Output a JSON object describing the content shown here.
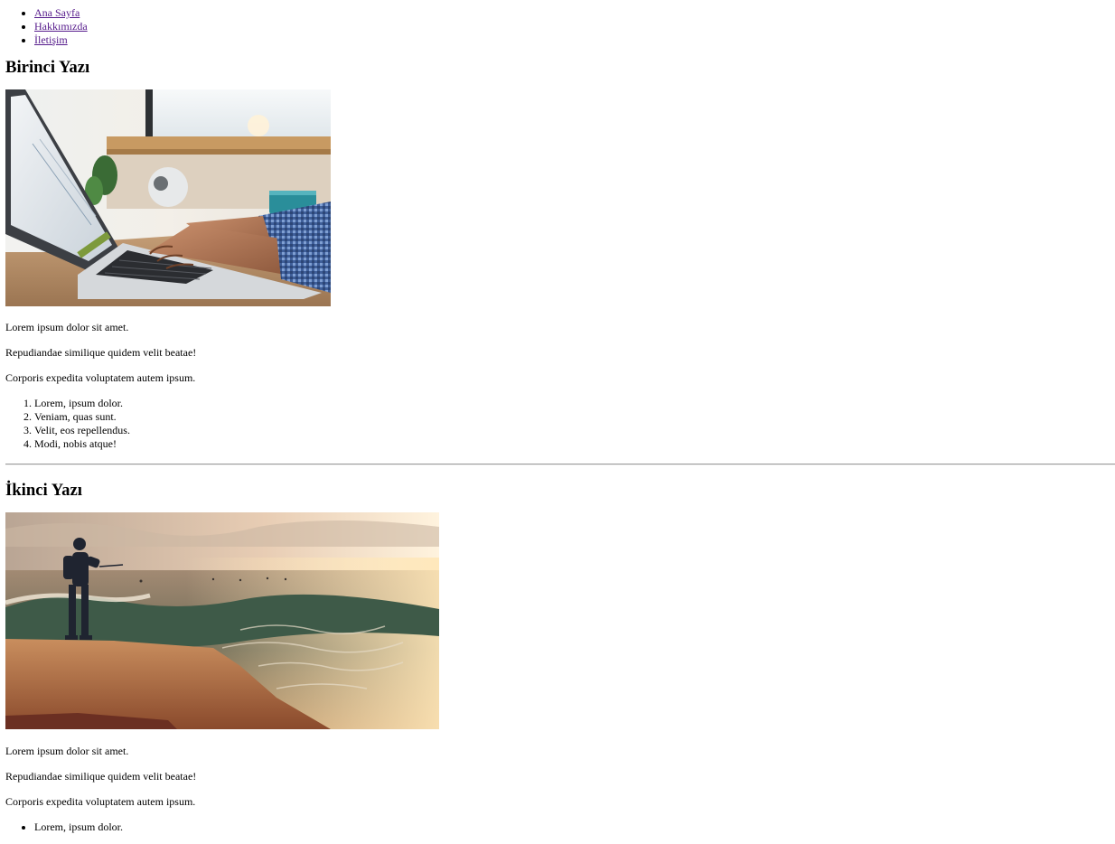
{
  "nav": {
    "items": [
      {
        "label": "Ana Sayfa"
      },
      {
        "label": "Hakkımızda"
      },
      {
        "label": "İletişim"
      }
    ]
  },
  "posts": [
    {
      "title": "Birinci Yazı",
      "image": "laptop-typing-photo",
      "paragraphs": [
        "Lorem ipsum dolor sit amet.",
        "Repudiandae similique quidem velit beatae!",
        "Corporis expedita voluptatem autem ipsum."
      ],
      "list_type": "ordered",
      "list": [
        "Lorem, ipsum dolor.",
        "Veniam, quas sunt.",
        "Velit, eos repellendus.",
        "Modi, nobis atque!"
      ]
    },
    {
      "title": "İkinci Yazı",
      "image": "fisherman-seaside-photo",
      "paragraphs": [
        "Lorem ipsum dolor sit amet.",
        "Repudiandae similique quidem velit beatae!",
        "Corporis expedita voluptatem autem ipsum."
      ],
      "list_type": "unordered",
      "list": [
        "Lorem, ipsum dolor."
      ]
    }
  ],
  "colors": {
    "link": "#551a8b",
    "text": "#000000",
    "background": "#ffffff",
    "divider": "#9a9a9a"
  }
}
